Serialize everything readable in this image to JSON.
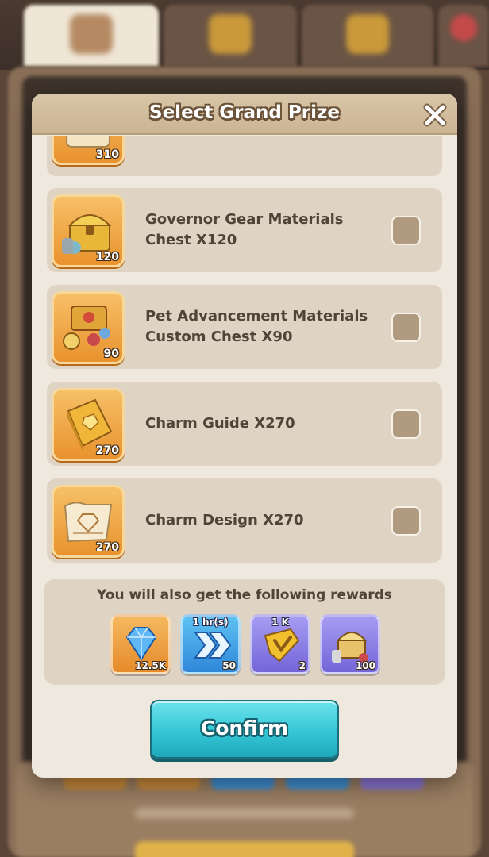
{
  "modal": {
    "title": "Select Grand Prize",
    "close_icon": "close-x-icon"
  },
  "prize_list": {
    "partial_item": {
      "quantity": "310",
      "icon": "scroll-icon"
    },
    "items": [
      {
        "label": "Governor Gear Materials Chest X120",
        "quantity": "120",
        "icon": "treasure-chest-icon",
        "checked": false
      },
      {
        "label": "Pet Advancement Materials Custom Chest X90",
        "quantity": "90",
        "icon": "pet-materials-chest-icon",
        "checked": false
      },
      {
        "label": "Charm Guide X270",
        "quantity": "270",
        "icon": "charm-guide-book-icon",
        "checked": false
      },
      {
        "label": "Charm Design X270",
        "quantity": "270",
        "icon": "charm-design-scroll-icon",
        "checked": false
      }
    ]
  },
  "rewards": {
    "title": "You will also get the following rewards",
    "items": [
      {
        "icon": "diamond-gem-icon",
        "quantity": "12.5K",
        "top_label": ""
      },
      {
        "icon": "speedup-arrows-icon",
        "quantity": "50",
        "top_label": "1 hr(s)"
      },
      {
        "icon": "gold-badge-icon",
        "quantity": "2",
        "top_label": "1 K"
      },
      {
        "icon": "gear-chest-icon",
        "quantity": "100",
        "top_label": ""
      }
    ]
  },
  "confirm_label": "Confirm",
  "colors": {
    "modal_bg": "#efe8de",
    "row_bg": "#dfd4c4",
    "header_bg": "#cbb493",
    "confirm": "#35c6d6",
    "text": "#4f4438"
  }
}
